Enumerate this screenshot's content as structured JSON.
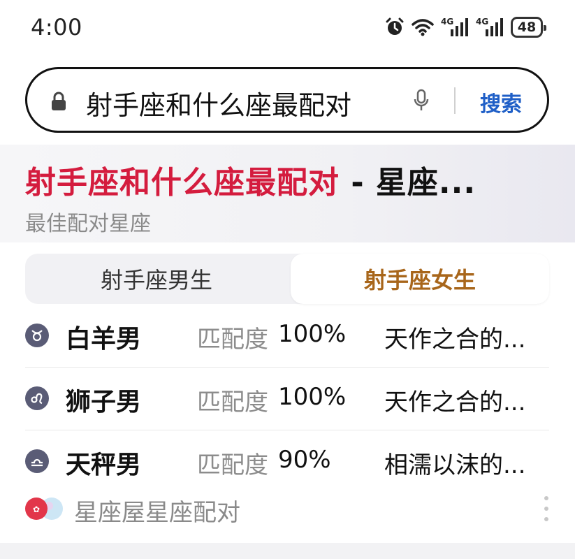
{
  "status_bar": {
    "time": "4:00",
    "network_1": "4G",
    "network_2": "4G",
    "battery": "48",
    "icons": [
      "alarm-icon",
      "wifi-icon",
      "signal-icon",
      "signal-icon",
      "battery-icon"
    ]
  },
  "search": {
    "query": "射手座和什么座最配对",
    "button_label": "搜索",
    "accent_color": "#1f5fc7"
  },
  "card": {
    "title_highlight": "射手座和什么座最配对",
    "title_rest": " - 星座...",
    "subtitle": "最佳配对星座",
    "highlight_color": "#d41c3e",
    "tabs": [
      {
        "label": "射手座男生",
        "selected": false
      },
      {
        "label": "射手座女生",
        "selected": true
      }
    ],
    "match_label": "匹配度",
    "rows": [
      {
        "icon": "taurus-icon",
        "name": "白羊男",
        "value": "100%",
        "desc": "天作之合的..."
      },
      {
        "icon": "leo-icon",
        "name": "狮子男",
        "value": "100%",
        "desc": "天作之合的..."
      },
      {
        "icon": "libra-icon",
        "name": "天秤男",
        "value": "90%",
        "desc": "相濡以沫的..."
      }
    ],
    "source": "星座屋星座配对"
  }
}
